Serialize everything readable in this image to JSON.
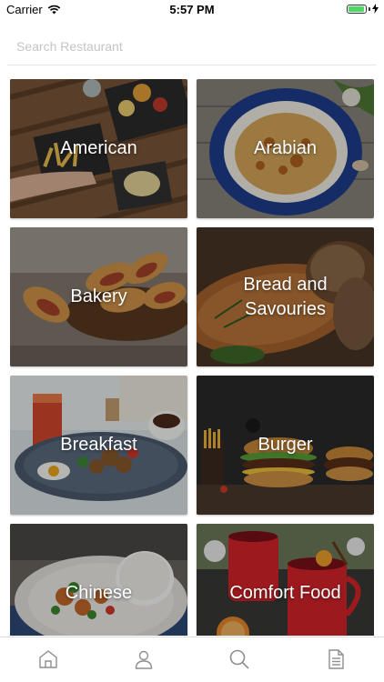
{
  "status_bar": {
    "carrier": "Carrier",
    "time": "5:57 PM",
    "battery_level": 0.95
  },
  "search": {
    "placeholder": "Search Restaurant",
    "value": ""
  },
  "categories": [
    {
      "label": "American"
    },
    {
      "label": "Arabian"
    },
    {
      "label": "Bakery"
    },
    {
      "label": "Bread and Savouries"
    },
    {
      "label": "Breakfast"
    },
    {
      "label": "Burger"
    },
    {
      "label": "Chinese"
    },
    {
      "label": "Comfort Food"
    }
  ],
  "tabbar": {
    "tabs": [
      {
        "icon": "home-icon"
      },
      {
        "icon": "user-icon"
      },
      {
        "icon": "search-icon",
        "active": true
      },
      {
        "icon": "document-icon"
      }
    ]
  },
  "colors": {
    "battery": "#4cd964",
    "tab_icon": "#8e8e93"
  }
}
